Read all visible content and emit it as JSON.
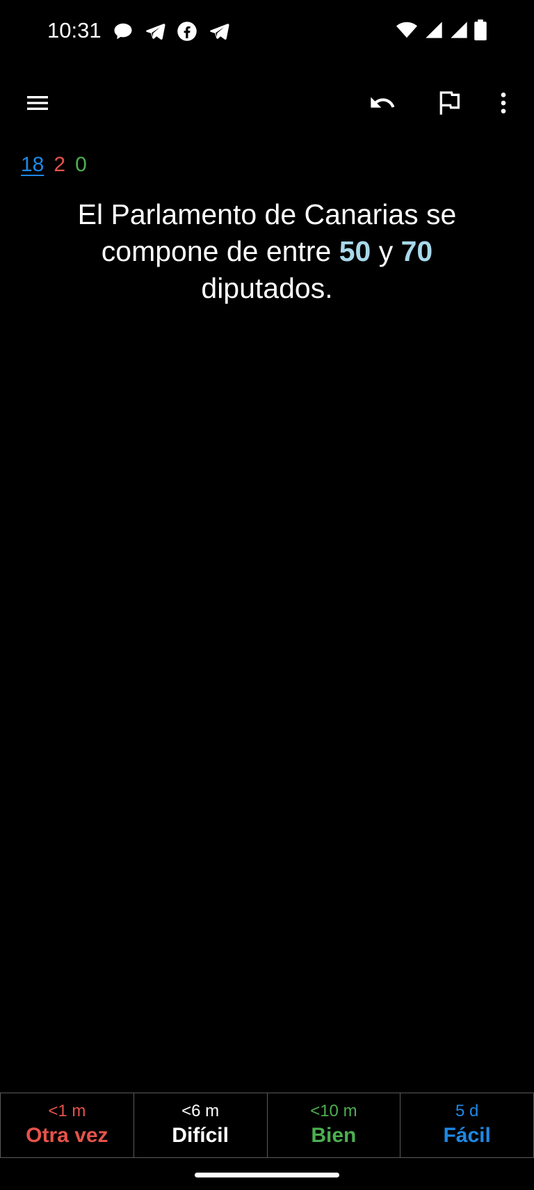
{
  "status_bar": {
    "time": "10:31",
    "notification_icons": [
      "chat-bubble-icon",
      "telegram-icon",
      "facebook-icon",
      "telegram-icon"
    ],
    "system_icons": [
      "wifi-icon",
      "signal-icon",
      "signal-icon",
      "battery-icon"
    ]
  },
  "toolbar": {
    "icons": [
      "menu-icon",
      "undo-icon",
      "flag-icon",
      "more-vert-icon"
    ]
  },
  "counts": {
    "new": "18",
    "learning": "2",
    "review": "0"
  },
  "card": {
    "text_before": "El Parlamento de Canarias se compone de entre ",
    "cloze1": "50",
    "text_middle": " y ",
    "cloze2": "70",
    "text_after": " diputados."
  },
  "answer_buttons": [
    {
      "time": "<1 m",
      "label": "Otra vez",
      "color": "#e5534b"
    },
    {
      "time": "<6 m",
      "label": "Difícil",
      "color": "#ffffff"
    },
    {
      "time": "<10 m",
      "label": "Bien",
      "color": "#4caf50"
    },
    {
      "time": "5 d",
      "label": "Fácil",
      "color": "#1e88e5"
    }
  ],
  "colors": {
    "background": "#000000",
    "cloze": "#a8d8ea",
    "new": "#1e88e5",
    "learning": "#e5534b",
    "review": "#4caf50"
  }
}
